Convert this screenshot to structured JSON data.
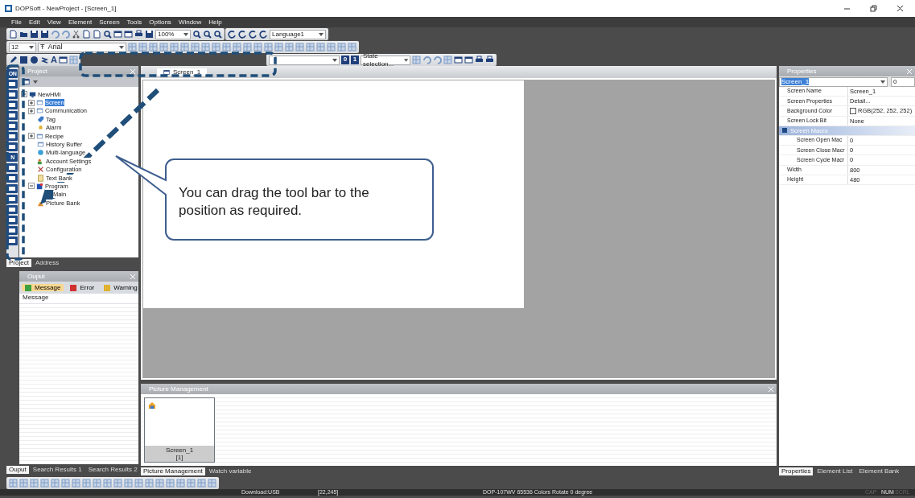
{
  "window": {
    "title": "DOPSoft - NewProject - [Screen_1]"
  },
  "menu": [
    "File",
    "Edit",
    "View",
    "Element",
    "Screen",
    "Tools",
    "Options",
    "Window",
    "Help"
  ],
  "toolbar": {
    "zoom": "100%",
    "language": "Language1",
    "font_size": "12",
    "font": "Arial",
    "font_glyph": "Ŧ",
    "text_tool_glyph": "A",
    "bits": [
      "0",
      "1"
    ],
    "state_selection": "State selection..."
  },
  "vertical_toolbar": [
    {
      "kind": "glyph",
      "text": "ON"
    },
    {
      "kind": "icon"
    },
    {
      "kind": "icon"
    },
    {
      "kind": "icon"
    },
    {
      "kind": "icon"
    },
    {
      "kind": "icon"
    },
    {
      "kind": "icon"
    },
    {
      "kind": "icon"
    },
    {
      "kind": "glyph",
      "text": "N"
    },
    {
      "kind": "icon"
    },
    {
      "kind": "icon"
    },
    {
      "kind": "icon"
    },
    {
      "kind": "icon"
    },
    {
      "kind": "icon"
    },
    {
      "kind": "icon"
    },
    {
      "kind": "icon"
    },
    {
      "kind": "icon"
    }
  ],
  "project_panel": {
    "title": "Project",
    "tree": [
      {
        "label": "NewHMI",
        "selected": false,
        "expanded": true,
        "children": [
          {
            "label": "Screen",
            "selected": true,
            "expanded": false
          },
          {
            "label": "Communication",
            "selected": false,
            "expanded": false
          },
          {
            "label": "Tag",
            "selected": false
          },
          {
            "label": "Alarm",
            "selected": false
          },
          {
            "label": "Recipe",
            "selected": false,
            "expanded": false
          },
          {
            "label": "History Buffer",
            "selected": false
          },
          {
            "label": "Multi-language",
            "selected": false
          },
          {
            "label": "Account Settings",
            "selected": false
          },
          {
            "label": "Configuration",
            "selected": false
          },
          {
            "label": "Text Bank",
            "selected": false
          },
          {
            "label": "Program",
            "selected": false,
            "expanded": true,
            "children": [
              {
                "label": "Main",
                "selected": false
              }
            ]
          },
          {
            "label": "Picture Bank",
            "selected": false
          }
        ]
      }
    ],
    "tabs": [
      {
        "label": "Project",
        "selected": true
      },
      {
        "label": "Address",
        "selected": false
      }
    ]
  },
  "output_panel": {
    "title": "Ouput",
    "filters": [
      {
        "label": "Message",
        "selected": true
      },
      {
        "label": "Error",
        "selected": false
      },
      {
        "label": "Warning",
        "selected": false
      }
    ],
    "column": "Message",
    "tabs": [
      {
        "label": "Ouput",
        "selected": true
      },
      {
        "label": "Search Results 1",
        "selected": false
      },
      {
        "label": "Search Results 2",
        "selected": false
      }
    ]
  },
  "editor": {
    "tab": "Screen_1"
  },
  "picture_management": {
    "title": "Picture Management",
    "items": [
      {
        "name": "Screen_1",
        "index": "[1]"
      }
    ],
    "tabs": [
      {
        "label": "Picture Management",
        "selected": true
      },
      {
        "label": "Watch variable",
        "selected": false
      }
    ]
  },
  "properties_panel": {
    "title": "Properties",
    "selector": "Screen_1",
    "index": "0",
    "rows": [
      {
        "kind": "field",
        "name": "Screen Name",
        "value": "Screen_1"
      },
      {
        "kind": "field",
        "name": "Screen Properties",
        "value": "Detail..."
      },
      {
        "kind": "color",
        "name": "Background Color",
        "value": "RGB(252, 252, 252)",
        "color": "#fcfcfc"
      },
      {
        "kind": "field",
        "name": "Screen Lock Bit",
        "value": "None"
      },
      {
        "kind": "group",
        "name": "Screen Macro"
      },
      {
        "kind": "subfield",
        "name": "Screen Open Mac",
        "value": "0"
      },
      {
        "kind": "subfield",
        "name": "Screen Close Macr",
        "value": "0"
      },
      {
        "kind": "subfield",
        "name": "Screen Cycle Macr",
        "value": "0"
      },
      {
        "kind": "field",
        "name": "Width",
        "value": "800"
      },
      {
        "kind": "field",
        "name": "Height",
        "value": "480"
      }
    ],
    "tabs": [
      {
        "label": "Properties",
        "selected": true
      },
      {
        "label": "Element List",
        "selected": false
      },
      {
        "label": "Element Bank",
        "selected": false
      }
    ]
  },
  "status_bar": [
    {
      "text": "Download:USB",
      "on": true
    },
    {
      "text": "[22,245]",
      "on": true
    },
    {
      "text": "DOP-107WV 65536 Colors Rotate 0 degree",
      "on": true
    },
    {
      "text": "CAP",
      "on": false
    },
    {
      "text": "NUM",
      "on": true
    },
    {
      "text": "SCRL",
      "on": false
    }
  ],
  "callout": {
    "text": "You can drag the tool bar to the position as required."
  }
}
